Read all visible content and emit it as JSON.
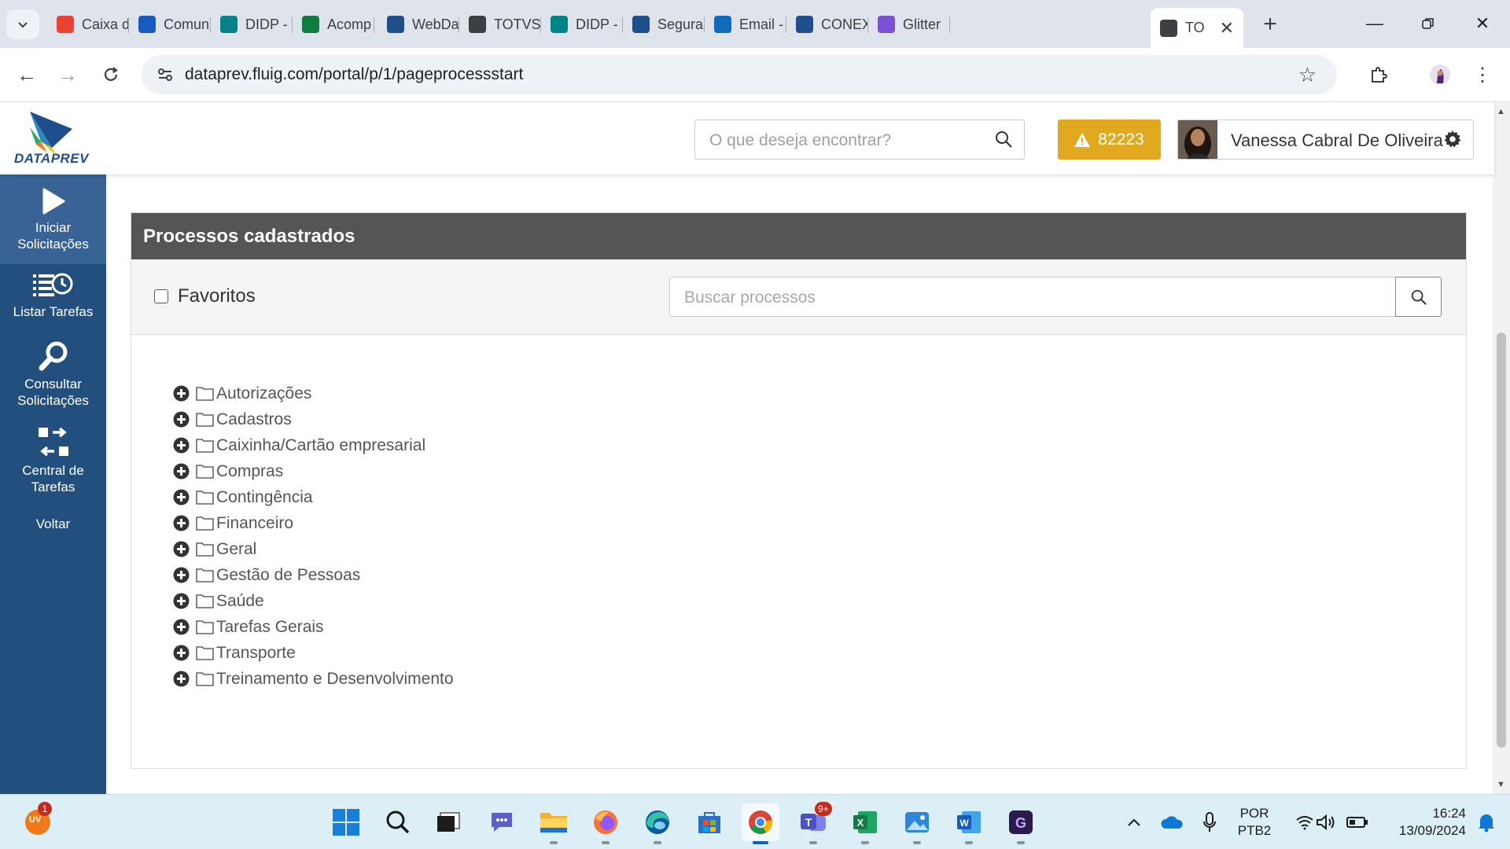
{
  "browser": {
    "tabs": [
      {
        "title": "Caixa d",
        "icon": "gmail-icon",
        "color": "#ea4335"
      },
      {
        "title": "Comun",
        "icon": "word-icon",
        "color": "#185abd"
      },
      {
        "title": "DIDP -",
        "icon": "sharepoint-icon",
        "color": "#038387"
      },
      {
        "title": "Acomp",
        "icon": "excel-icon",
        "color": "#107c41"
      },
      {
        "title": "WebDa",
        "icon": "dataprev-icon",
        "color": "#1f4e8c"
      },
      {
        "title": "TOTVS",
        "icon": "totvs-icon",
        "color": "#3c4043"
      },
      {
        "title": "DIDP -",
        "icon": "sharepoint-icon",
        "color": "#038387"
      },
      {
        "title": "Segura",
        "icon": "dataprev-icon",
        "color": "#1f4e8c"
      },
      {
        "title": "Email -",
        "icon": "outlook-icon",
        "color": "#0f6cbd"
      },
      {
        "title": "CONEX",
        "icon": "dataprev-icon",
        "color": "#1f4e8c"
      },
      {
        "title": "Glitter",
        "icon": "glitter-icon",
        "color": "#7b4fd6"
      },
      {
        "title": "TO",
        "icon": "totvs-icon",
        "color": "#3c4043"
      }
    ],
    "url": "dataprev.fluig.com/portal/p/1/pageprocessstart"
  },
  "header": {
    "logo_text": "DATAPREV",
    "search_placeholder": "O que deseja encontrar?",
    "alert_count": "82223",
    "user_name": "Vanessa Cabral De Oliveira"
  },
  "sidebar": {
    "items": [
      {
        "label": "Iniciar Solicitações",
        "icon": "play-icon"
      },
      {
        "label": "Listar Tarefas",
        "icon": "task-list-clock-icon"
      },
      {
        "label": "Consultar Solicitações",
        "icon": "magnifier-icon"
      },
      {
        "label": "Central de Tarefas",
        "icon": "swap-arrows-icon"
      },
      {
        "label": "Voltar",
        "icon": ""
      }
    ]
  },
  "panel": {
    "title": "Processos cadastrados",
    "favorites_label": "Favoritos",
    "favorites_checked": false,
    "search_placeholder": "Buscar processos",
    "categories": [
      "Autorizações",
      "Cadastros",
      "Caixinha/Cartão empresarial",
      "Compras",
      "Contingência",
      "Financeiro",
      "Geral",
      "Gestão de Pessoas",
      "Saúde",
      "Tarefas Gerais",
      "Transporte",
      "Treinamento e Desenvolvimento"
    ]
  },
  "taskbar": {
    "weather_badge": "1",
    "weather_text": "UV",
    "teams_badge": "9+",
    "language": "POR",
    "keyboard": "PTB2",
    "time": "16:24",
    "date": "13/09/2024"
  },
  "colors": {
    "sidebar": "#234f7e",
    "panel_header": "#555555",
    "alert": "#e0a91f"
  }
}
